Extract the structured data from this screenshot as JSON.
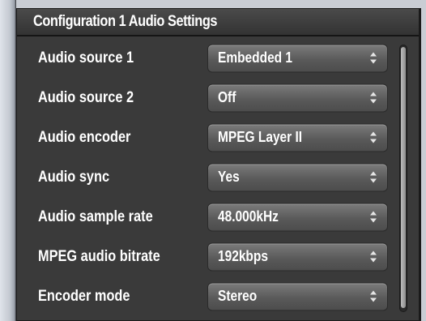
{
  "panel": {
    "title": "Configuration 1 Audio Settings"
  },
  "rows": [
    {
      "label": "Audio source 1",
      "value": "Embedded 1"
    },
    {
      "label": "Audio source 2",
      "value": "Off"
    },
    {
      "label": "Audio encoder",
      "value": "MPEG Layer II"
    },
    {
      "label": "Audio sync",
      "value": "Yes"
    },
    {
      "label": "Audio sample rate",
      "value": "48.000kHz"
    },
    {
      "label": "MPEG audio bitrate",
      "value": "192kbps"
    },
    {
      "label": "Encoder mode",
      "value": "Stereo"
    }
  ],
  "icons": {
    "select_arrow": "up-down-arrows-icon"
  },
  "colors": {
    "panel_bg": "#3a3a3a",
    "select_bg": "#5a5a5a",
    "text": "#ffffff"
  }
}
